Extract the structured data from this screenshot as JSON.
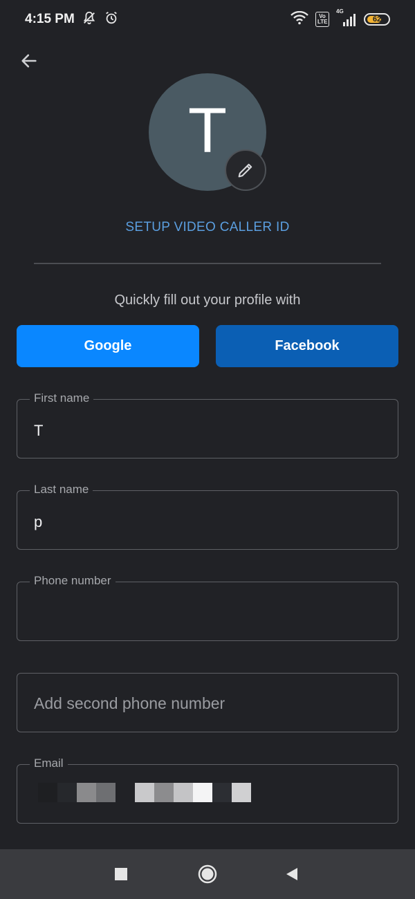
{
  "status_bar": {
    "time": "4:15 PM",
    "battery": "62",
    "network": "4G",
    "volte": "Vo LTE",
    "icons": [
      "mute-bell-icon",
      "alarm-icon",
      "wifi-icon",
      "volte-icon",
      "signal-icon",
      "battery-icon"
    ]
  },
  "header": {
    "back_icon": "arrow-left-icon"
  },
  "profile": {
    "avatar_letter": "T",
    "avatar_color": "#4a5a63",
    "edit_icon": "pencil-icon",
    "setup_link": "SETUP VIDEO CALLER ID",
    "link_color": "#5b9fe0"
  },
  "quick_fill": {
    "text": "Quickly fill out your profile with",
    "google_label": "Google",
    "facebook_label": "Facebook",
    "google_color": "#0a87ff",
    "facebook_color": "#0b5fb4"
  },
  "form": {
    "first_name": {
      "label": "First name",
      "value": "T"
    },
    "last_name": {
      "label": "Last name",
      "value": "p"
    },
    "phone": {
      "label": "Phone number",
      "value": ""
    },
    "second_phone": {
      "placeholder": "Add second phone number",
      "value": ""
    },
    "email": {
      "label": "Email"
    }
  },
  "nav_bar": {
    "icons": [
      "recents-square-icon",
      "home-circle-icon",
      "back-triangle-icon"
    ]
  }
}
